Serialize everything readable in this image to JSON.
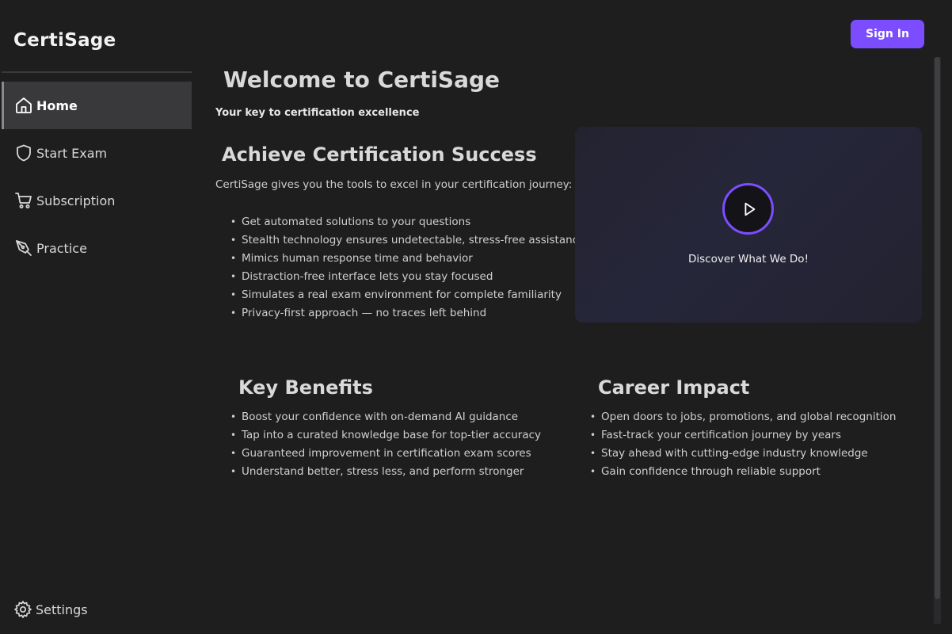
{
  "app": {
    "brand": "CertiSage"
  },
  "sidebar": {
    "items": [
      {
        "label": "Home",
        "icon": "home-icon",
        "active": true
      },
      {
        "label": "Start Exam",
        "icon": "shield-icon",
        "active": false
      },
      {
        "label": "Subscription",
        "icon": "cart-icon",
        "active": false
      },
      {
        "label": "Practice",
        "icon": "pen-icon",
        "active": false
      }
    ],
    "settings_label": "Settings"
  },
  "header": {
    "signin_label": "Sign In"
  },
  "colors": {
    "accent": "#7c4dff",
    "background": "#1e1e1f",
    "active_nav": "#39393b"
  },
  "main": {
    "title": "Welcome to CertiSage",
    "tagline": "Your key to certification excellence",
    "achieve": {
      "heading": "Achieve Certification Success",
      "intro": "CertiSage gives you the tools to excel in your certification journey:",
      "bullets": [
        "Get automated solutions to your questions",
        "Stealth technology ensures undetectable, stress-free assistance",
        "Mimics human response time and behavior",
        "Distraction-free interface lets you stay focused",
        "Simulates a real exam environment for complete familiarity",
        "Privacy-first approach — no traces left behind"
      ]
    },
    "video": {
      "caption": "Discover What We Do!",
      "icon": "play-icon"
    },
    "benefits": {
      "heading": "Key Benefits",
      "bullets": [
        "Boost your confidence with on-demand AI guidance",
        "Tap into a curated knowledge base for top-tier accuracy",
        "Guaranteed improvement in certification exam scores",
        "Understand better, stress less, and perform stronger"
      ]
    },
    "career": {
      "heading": "Career Impact",
      "bullets": [
        "Open doors to jobs, promotions, and global recognition",
        "Fast-track your certification journey by years",
        "Stay ahead with cutting-edge industry knowledge",
        "Gain confidence through reliable support"
      ]
    }
  }
}
